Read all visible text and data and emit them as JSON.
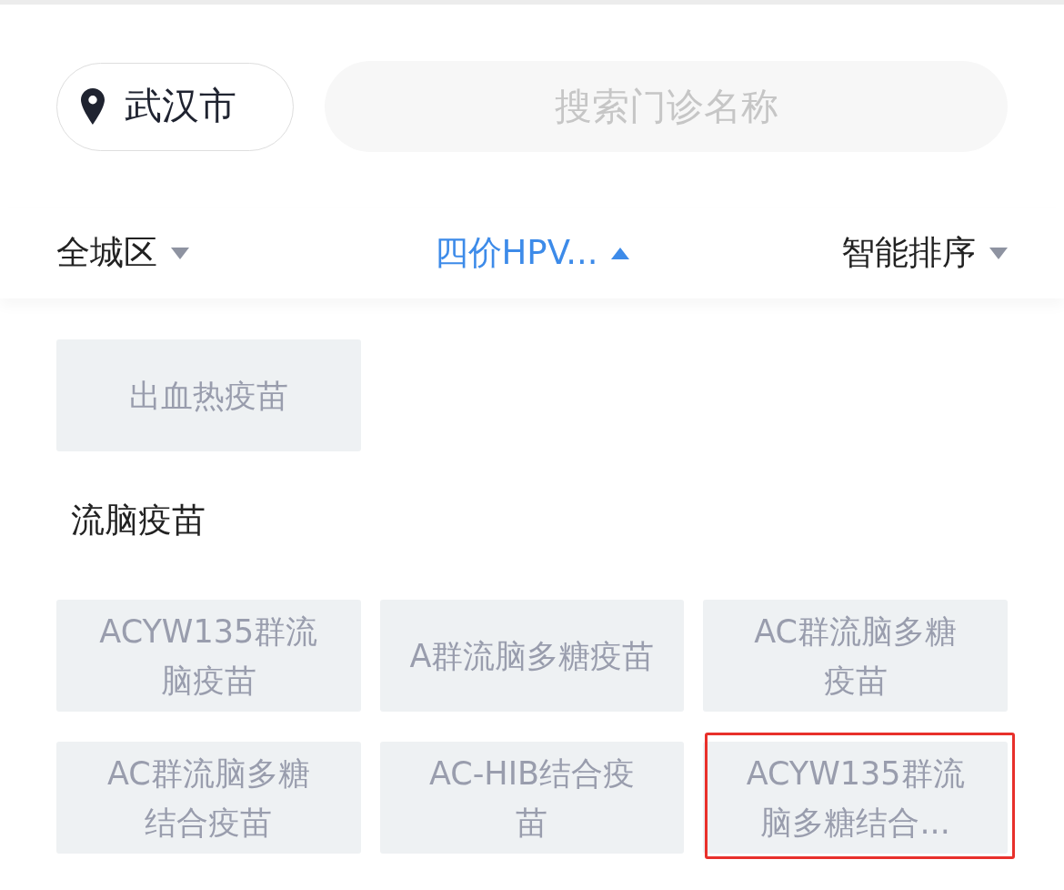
{
  "location": {
    "city": "武汉市"
  },
  "search": {
    "placeholder": "搜索门诊名称"
  },
  "filters": [
    {
      "label": "全城区",
      "selected": false,
      "expanded": false
    },
    {
      "label": "四价HPV...",
      "selected": true,
      "expanded": true
    },
    {
      "label": "智能排序",
      "selected": false,
      "expanded": false
    }
  ],
  "groups": [
    {
      "tiles": [
        {
          "lines": [
            "出血热疫苗"
          ],
          "highlighted": false
        }
      ]
    },
    {
      "title": "流脑疫苗",
      "tiles": [
        {
          "lines": [
            "ACYW135群流",
            "脑疫苗"
          ],
          "highlighted": false
        },
        {
          "lines": [
            "A群流脑多糖疫苗"
          ],
          "highlighted": false
        },
        {
          "lines": [
            "AC群流脑多糖",
            "疫苗"
          ],
          "highlighted": false
        },
        {
          "lines": [
            "AC群流脑多糖",
            "结合疫苗"
          ],
          "highlighted": false
        },
        {
          "lines": [
            "AC-HIB结合疫",
            "苗"
          ],
          "highlighted": false
        },
        {
          "lines": [
            "ACYW135群流",
            "脑多糖结合..."
          ],
          "highlighted": true
        }
      ]
    }
  ]
}
